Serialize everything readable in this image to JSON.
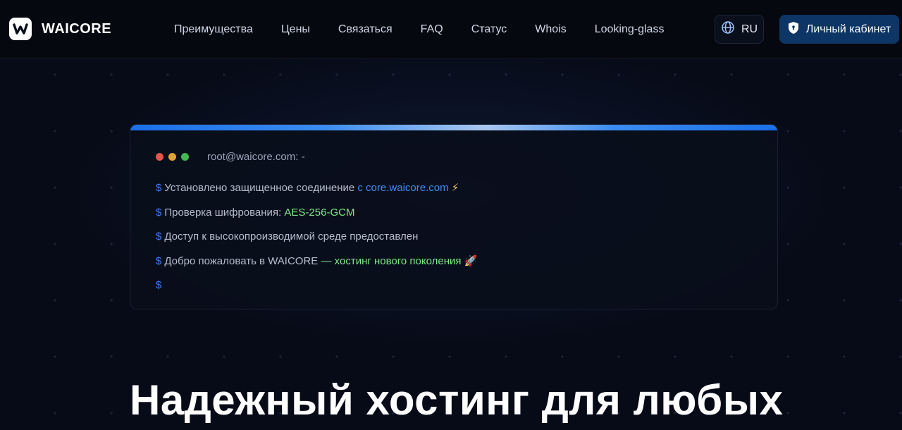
{
  "header": {
    "logo_text": "WAICORE",
    "nav": [
      "Преимущества",
      "Цены",
      "Связаться",
      "FAQ",
      "Статус",
      "Whois",
      "Looking-glass"
    ],
    "lang_label": "RU",
    "cabinet_label": "Личный кабинет"
  },
  "terminal": {
    "title": "root@waicore.com: -",
    "prompt": "$",
    "lines": [
      {
        "text": "Установлено защищенное соединение",
        "highlight": "с core.waicore.com",
        "emoji": "⚡"
      },
      {
        "text": "Проверка шифрования:",
        "highlight": "AES-256-GCM",
        "emoji": ""
      },
      {
        "text": "Доступ к высокопроизводимой среде предоставлен",
        "highlight": "",
        "emoji": ""
      },
      {
        "text": "Добро пожаловать в WAICORE",
        "highlight": "— хостинг нового поколения",
        "emoji": "🚀"
      },
      {
        "text": "",
        "highlight": "",
        "emoji": ""
      }
    ]
  },
  "hero": {
    "headline": "Надежный хостинг для любых"
  },
  "colors": {
    "background": "#070b18",
    "accent_blue": "#3b82f6",
    "accent_green": "#7ee787",
    "cabinet_button": "#0d3566"
  },
  "icons": {
    "logo": "waicore-logo-icon",
    "lang": "globe-icon",
    "cabinet": "shield-icon"
  }
}
